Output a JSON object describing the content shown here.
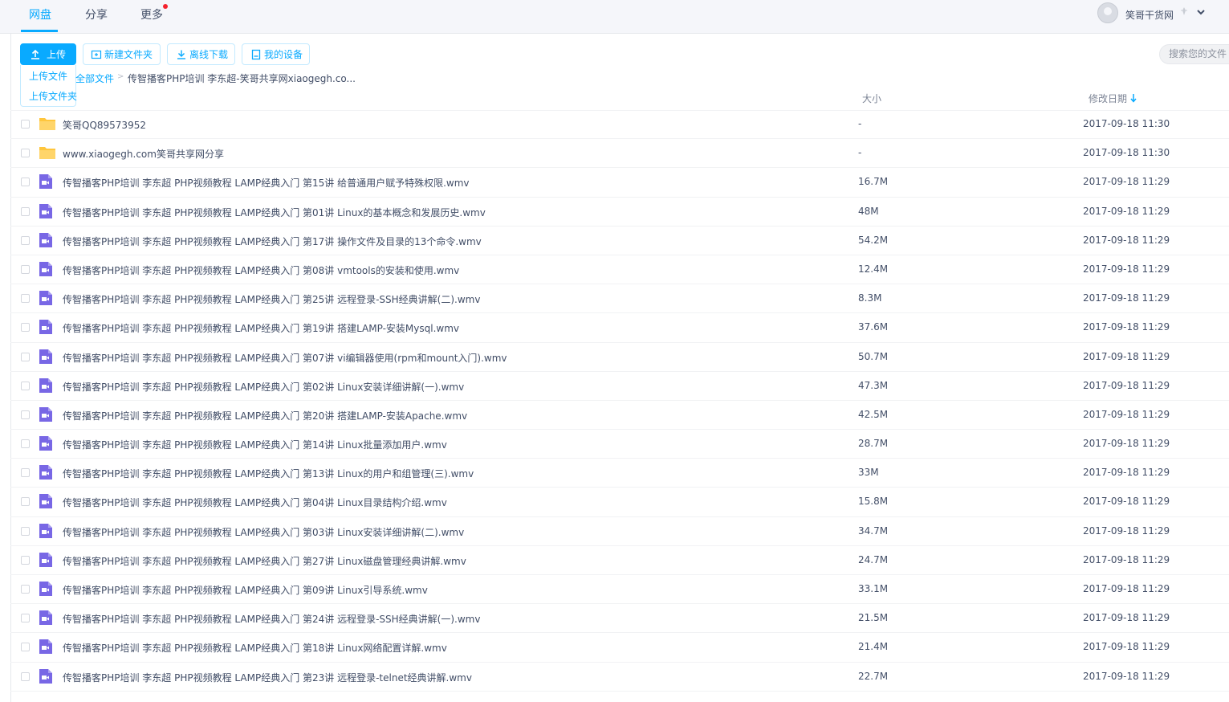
{
  "topbar": {
    "tabs": [
      {
        "label": "网盘"
      },
      {
        "label": "分享"
      },
      {
        "label": "更多"
      }
    ],
    "username": "笑哥干货网"
  },
  "toolbar": {
    "upload_label": "上传",
    "upload_menu": [
      "上传文件",
      "上传文件夹"
    ],
    "new_folder_label": "新建文件夹",
    "offline_download_label": "离线下载",
    "my_devices_label": "我的设备",
    "search_placeholder": "搜索您的文件"
  },
  "breadcrumb": {
    "root": "全部文件",
    "separator": ">",
    "current": "传智播客PHP培训 李东超-笑哥共享网xiaogegh.co..."
  },
  "columns": {
    "size": "大小",
    "modified": "修改日期"
  },
  "colors": {
    "accent": "#09aaff",
    "folder": "#ffc63d",
    "video": "#7867e5"
  },
  "files": [
    {
      "type": "folder",
      "name": "笑哥QQ89573952",
      "size": "-",
      "date": "2017-09-18 11:30"
    },
    {
      "type": "folder",
      "name": "www.xiaogegh.com笑哥共享网分享",
      "size": "-",
      "date": "2017-09-18 11:30"
    },
    {
      "type": "video",
      "name": "传智播客PHP培训 李东超 PHP视频教程 LAMP经典入门 第15讲 给普通用户赋予特殊权限.wmv",
      "size": "16.7M",
      "date": "2017-09-18 11:29"
    },
    {
      "type": "video",
      "name": "传智播客PHP培训 李东超 PHP视频教程 LAMP经典入门 第01讲 Linux的基本概念和发展历史.wmv",
      "size": "48M",
      "date": "2017-09-18 11:29"
    },
    {
      "type": "video",
      "name": "传智播客PHP培训 李东超 PHP视频教程 LAMP经典入门 第17讲 操作文件及目录的13个命令.wmv",
      "size": "54.2M",
      "date": "2017-09-18 11:29"
    },
    {
      "type": "video",
      "name": "传智播客PHP培训 李东超 PHP视频教程 LAMP经典入门 第08讲 vmtools的安装和使用.wmv",
      "size": "12.4M",
      "date": "2017-09-18 11:29"
    },
    {
      "type": "video",
      "name": "传智播客PHP培训 李东超 PHP视频教程 LAMP经典入门 第25讲 远程登录-SSH经典讲解(二).wmv",
      "size": "8.3M",
      "date": "2017-09-18 11:29"
    },
    {
      "type": "video",
      "name": "传智播客PHP培训 李东超 PHP视频教程 LAMP经典入门 第19讲 搭建LAMP-安装Mysql.wmv",
      "size": "37.6M",
      "date": "2017-09-18 11:29"
    },
    {
      "type": "video",
      "name": "传智播客PHP培训 李东超 PHP视频教程 LAMP经典入门 第07讲 vi编辑器使用(rpm和mount入门).wmv",
      "size": "50.7M",
      "date": "2017-09-18 11:29"
    },
    {
      "type": "video",
      "name": "传智播客PHP培训 李东超 PHP视频教程 LAMP经典入门 第02讲 Linux安装详细讲解(一).wmv",
      "size": "47.3M",
      "date": "2017-09-18 11:29"
    },
    {
      "type": "video",
      "name": "传智播客PHP培训 李东超 PHP视频教程 LAMP经典入门 第20讲 搭建LAMP-安装Apache.wmv",
      "size": "42.5M",
      "date": "2017-09-18 11:29"
    },
    {
      "type": "video",
      "name": "传智播客PHP培训 李东超 PHP视频教程 LAMP经典入门 第14讲 Linux批量添加用户.wmv",
      "size": "28.7M",
      "date": "2017-09-18 11:29"
    },
    {
      "type": "video",
      "name": "传智播客PHP培训 李东超 PHP视频教程 LAMP经典入门 第13讲 Linux的用户和组管理(三).wmv",
      "size": "33M",
      "date": "2017-09-18 11:29"
    },
    {
      "type": "video",
      "name": "传智播客PHP培训 李东超 PHP视频教程 LAMP经典入门 第04讲 Linux目录结构介绍.wmv",
      "size": "15.8M",
      "date": "2017-09-18 11:29"
    },
    {
      "type": "video",
      "name": "传智播客PHP培训 李东超 PHP视频教程 LAMP经典入门 第03讲 Linux安装详细讲解(二).wmv",
      "size": "34.7M",
      "date": "2017-09-18 11:29"
    },
    {
      "type": "video",
      "name": "传智播客PHP培训 李东超 PHP视频教程 LAMP经典入门 第27讲 Linux磁盘管理经典讲解.wmv",
      "size": "24.7M",
      "date": "2017-09-18 11:29"
    },
    {
      "type": "video",
      "name": "传智播客PHP培训 李东超 PHP视频教程 LAMP经典入门 第09讲 Linux引导系统.wmv",
      "size": "33.1M",
      "date": "2017-09-18 11:29"
    },
    {
      "type": "video",
      "name": "传智播客PHP培训 李东超 PHP视频教程 LAMP经典入门 第24讲 远程登录-SSH经典讲解(一).wmv",
      "size": "21.5M",
      "date": "2017-09-18 11:29"
    },
    {
      "type": "video",
      "name": "传智播客PHP培训 李东超 PHP视频教程 LAMP经典入门 第18讲 Linux网络配置详解.wmv",
      "size": "21.4M",
      "date": "2017-09-18 11:29"
    },
    {
      "type": "video",
      "name": "传智播客PHP培训 李东超 PHP视频教程 LAMP经典入门 第23讲 远程登录-telnet经典讲解.wmv",
      "size": "22.7M",
      "date": "2017-09-18 11:29"
    }
  ]
}
